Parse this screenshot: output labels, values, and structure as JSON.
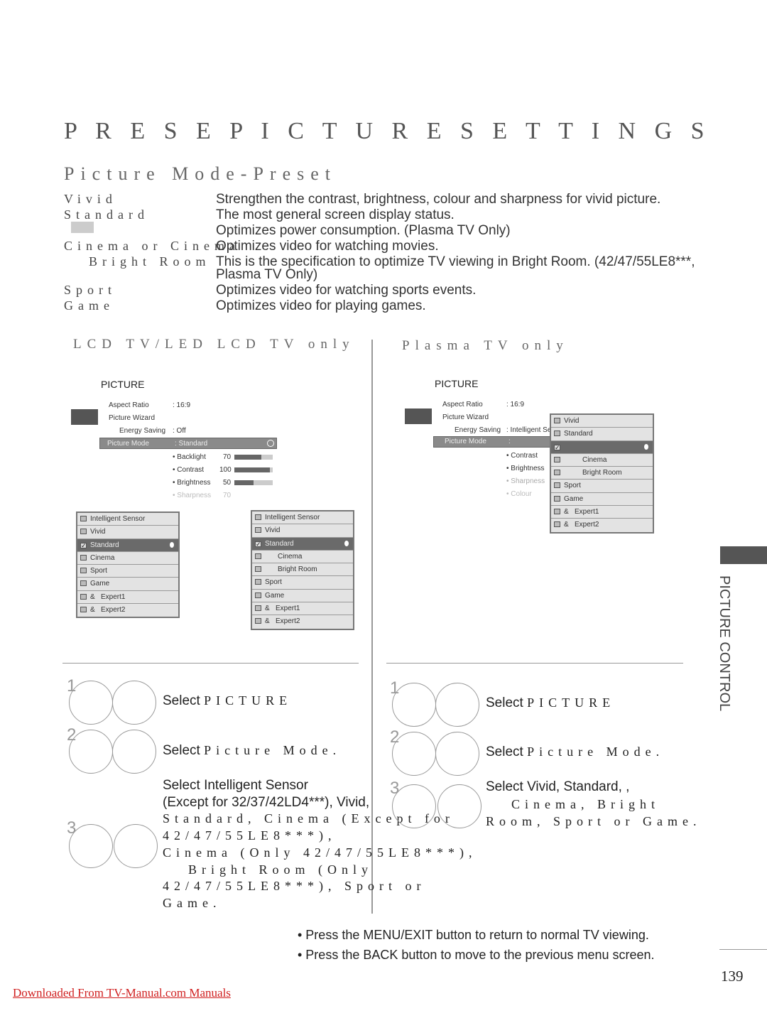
{
  "title": "P R E S E  P I C T U R E S E T T I N G S",
  "subtitle": "Picture Mode-Preset",
  "modes": [
    {
      "label": "Vivid",
      "desc": "Strengthen the contrast, brightness, colour and sharpness for vivid picture."
    },
    {
      "label": "Standard",
      "desc": "The most general screen display status."
    },
    {
      "label": "",
      "desc": "Optimizes power consumption. (Plasma TV Only)"
    },
    {
      "label": "Cinema or Cinema",
      "desc": "Optimizes video for watching movies."
    },
    {
      "label": "Bright Room",
      "desc": "This is the specification to optimize TV viewing in Bright Room. (42/47/55LE8***,",
      "desc2": "Plasma TV Only)"
    },
    {
      "label": "Sport",
      "desc": "Optimizes video for watching sports events."
    },
    {
      "label": "Game",
      "desc": "Optimizes video for playing games."
    }
  ],
  "lcd": {
    "heading": "LCD TV/LED LCD TV only",
    "menu_title": "PICTURE",
    "aspect_ratio": "Aspect Ratio",
    "aspect_value": ": 16:9",
    "picture_wizard": "Picture Wizard",
    "energy_saving": "Energy Saving",
    "energy_value": ": Off",
    "picture_mode": "Picture Mode",
    "picture_mode_value": ": Standard",
    "settings": [
      {
        "label": "• Backlight",
        "value": "70",
        "fill": 70
      },
      {
        "label": "• Contrast",
        "value": "100",
        "fill": 100
      },
      {
        "label": "• Brightness",
        "value": "50",
        "fill": 50
      },
      {
        "label": "• Sharpness",
        "value": "70"
      }
    ],
    "dropdown_a": [
      "Intelligent Sensor",
      "Vivid",
      "Standard",
      "Cinema",
      "Sport",
      "Game",
      "&   Expert1",
      "&   Expert2"
    ],
    "dropdown_b": [
      "Intelligent Sensor",
      "Vivid",
      "Standard",
      "Cinema",
      "Bright Room",
      "Sport",
      "Game",
      "&   Expert1",
      "&   Expert2"
    ],
    "selected": "Standard"
  },
  "plasma": {
    "heading": "Plasma TV only",
    "menu_title": "PICTURE",
    "aspect_ratio": "Aspect Ratio",
    "aspect_value": ": 16:9",
    "picture_wizard": "Picture Wizard",
    "energy_saving": "Energy Saving",
    "energy_value": ": Intelligent Se",
    "picture_mode": "Picture Mode",
    "picture_mode_value": ":",
    "settings": [
      "• Contrast",
      "• Brightness",
      "• Sharpness",
      "• Colour"
    ],
    "dropdown": [
      "Vivid",
      "Standard",
      "",
      "Cinema",
      "Bright Room",
      "Sport",
      "Game",
      "&   Expert1",
      "&   Expert2"
    ]
  },
  "steps_left": [
    {
      "num": "1",
      "text": "Select ",
      "em": "PICTURE"
    },
    {
      "num": "2",
      "text": "Select ",
      "em": "Picture Mode."
    },
    {
      "num": "3",
      "lines": [
        "Select Intelligent Sensor",
        "(Except for 32/37/42LD4***), Vivid,",
        "Standard, Cinema (Except for",
        "42/47/55LE8***),",
        "Cinema (Only 42/47/55LE8***),",
        "Bright Room (Only",
        "42/47/55LE8***), Sport or",
        "Game."
      ]
    }
  ],
  "steps_right": [
    {
      "num": "1",
      "text": "Select ",
      "em": "PICTURE"
    },
    {
      "num": "2",
      "text": "Select ",
      "em": "Picture Mode."
    },
    {
      "num": "3",
      "lines": [
        "Select Vivid, Standard, ,",
        "Cinema, Bright",
        "Room, Sport or Game."
      ]
    }
  ],
  "notes": [
    "• Press the MENU/EXIT button to return to normal TV viewing.",
    "• Press the BACK button to move to the previous menu screen."
  ],
  "side_tab": "PICTURE CONTROL",
  "page_number": "139",
  "footer_link": "Downloaded From TV-Manual.com Manuals",
  "colors": {
    "link": "#d02020",
    "highlight": "#6a6a6a"
  }
}
